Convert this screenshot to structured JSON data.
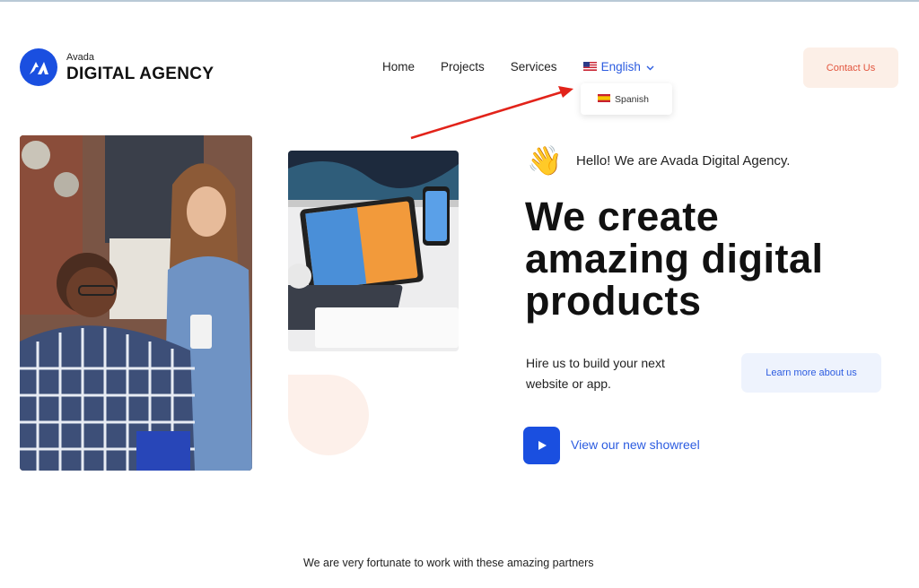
{
  "brand": {
    "small": "Avada",
    "name": "DIGITAL AGENCY",
    "color": "#1a4fe0"
  },
  "nav": {
    "items": [
      "Home",
      "Projects",
      "Services"
    ],
    "language": "English",
    "dropdown_option": "Spanish"
  },
  "header": {
    "contact_label": "Contact Us"
  },
  "hero": {
    "hello": "Hello! We are Avada Digital Agency.",
    "headline": [
      "We create",
      "amazing digital",
      "products"
    ],
    "sub": [
      "Hire us to build your next",
      "website or app."
    ],
    "learn_label": "Learn more about us",
    "showreel_label": "View our new showreel"
  },
  "partners_text": "We are very fortunate to work with these amazing partners",
  "colors": {
    "accent": "#2c5ce0",
    "contact_bg": "#fcefe7",
    "contact_text": "#e2543d",
    "learn_bg": "#eef3fd"
  },
  "icons": [
    "logo-icon",
    "us-flag-icon",
    "chevron-down-icon",
    "spain-flag-icon",
    "waving-hand-icon",
    "play-icon",
    "annotation-arrow"
  ]
}
